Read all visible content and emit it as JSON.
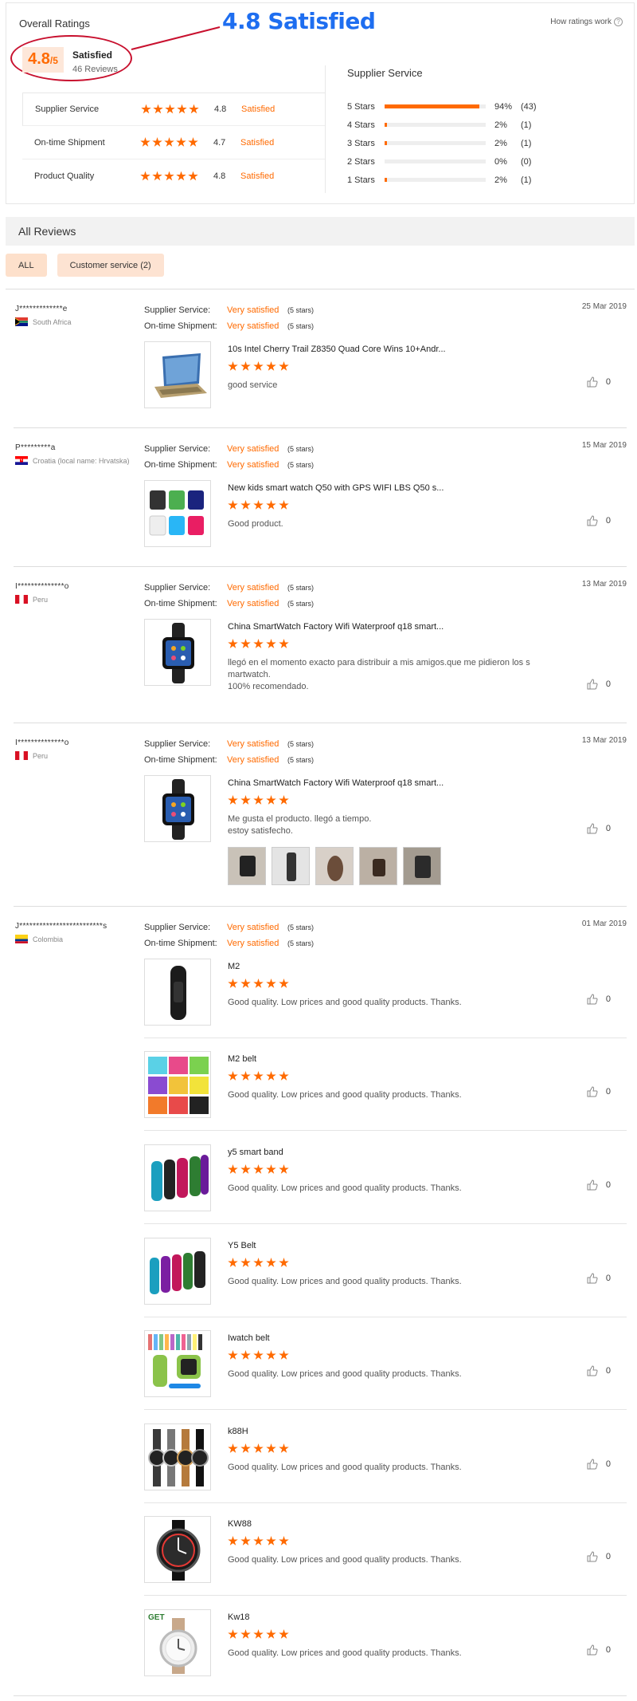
{
  "overall": {
    "title": "Overall Ratings",
    "how_link": "How ratings work",
    "score_main": "4.8",
    "score_suffix": "/5",
    "score_label": "Satisfied",
    "review_count": "46 Reviews",
    "annotation": "4.8 Satisfied"
  },
  "metrics": [
    {
      "name": "Supplier Service",
      "stars": 5,
      "value": "4.8",
      "word": "Satisfied"
    },
    {
      "name": "On-time Shipment",
      "stars": 5,
      "value": "4.7",
      "word": "Satisfied"
    },
    {
      "name": "Product Quality",
      "stars": 5,
      "value": "4.8",
      "word": "Satisfied"
    }
  ],
  "distribution": {
    "title": "Supplier Service",
    "rows": [
      {
        "label": "5 Stars",
        "fraction": 0.94,
        "pct": "94%",
        "count": "(43)"
      },
      {
        "label": "4 Stars",
        "fraction": 0.02,
        "pct": "2%",
        "count": "(1)"
      },
      {
        "label": "3 Stars",
        "fraction": 0.02,
        "pct": "2%",
        "count": "(1)"
      },
      {
        "label": "2 Stars",
        "fraction": 0.0,
        "pct": "0%",
        "count": "(0)"
      },
      {
        "label": "1 Stars",
        "fraction": 0.02,
        "pct": "2%",
        "count": "(1)"
      }
    ]
  },
  "reviews_header": "All Reviews",
  "filters": {
    "all": "ALL",
    "customer_service": "Customer service (2)"
  },
  "svc_labels": {
    "supplier": "Supplier Service:",
    "shipment": "On-time Shipment:",
    "value": "Very satisfied",
    "stars": "(5 stars)"
  },
  "reviews": [
    {
      "reviewer": "J*************e",
      "country": "South Africa",
      "date": "25 Mar 2019",
      "items": [
        {
          "title": "10s Intel Cherry Trail Z8350 Quad Core Wins 10+Andr...",
          "text": "good service",
          "likes": "0"
        }
      ]
    },
    {
      "reviewer": "P*********a",
      "country": "Croatia (local name: Hrvatska)",
      "date": "15 Mar 2019",
      "items": [
        {
          "title": "New kids smart watch Q50 with GPS WIFI LBS Q50 s...",
          "text": "Good product.",
          "likes": "0"
        }
      ]
    },
    {
      "reviewer": "I**************o",
      "country": "Peru",
      "date": "13 Mar 2019",
      "items": [
        {
          "title": "China SmartWatch Factory Wifi Waterproof q18 smart...",
          "text1": "llegó en el momento exacto para distribuir a mis amigos.que me pidieron los s",
          "text2": "martwatch.",
          "text3": "100% recomendado.",
          "likes": "0"
        }
      ]
    },
    {
      "reviewer": "I**************o",
      "country": "Peru",
      "date": "13 Mar 2019",
      "items": [
        {
          "title": "China SmartWatch Factory Wifi Waterproof q18 smart...",
          "text1": "Me gusta el producto. llegó a tiempo.",
          "text2": "estoy satisfecho.",
          "likes": "0"
        }
      ]
    },
    {
      "reviewer": "J*************************s",
      "country": "Colombia",
      "date": "01 Mar 2019",
      "items": [
        {
          "title": "M2",
          "text": "Good quality. Low prices and good quality products. Thanks.",
          "likes": "0"
        },
        {
          "title": "M2 belt",
          "text": "Good quality. Low prices and good quality products. Thanks.",
          "likes": "0"
        },
        {
          "title": "y5 smart band",
          "text": "Good quality. Low prices and good quality products. Thanks.",
          "likes": "0"
        },
        {
          "title": "Y5 Belt",
          "text": "Good quality. Low prices and good quality products. Thanks.",
          "likes": "0"
        },
        {
          "title": "Iwatch belt",
          "text": "Good quality. Low prices and good quality products. Thanks.",
          "likes": "0"
        },
        {
          "title": "k88H",
          "text": "Good quality. Low prices and good quality products. Thanks.",
          "likes": "0"
        },
        {
          "title": "KW88",
          "text": "Good quality. Low prices and good quality products. Thanks.",
          "likes": "0"
        },
        {
          "title": "Kw18",
          "text": "Good quality. Low prices and good quality products. Thanks.",
          "likes": "0",
          "badge": "GET"
        }
      ]
    }
  ],
  "colors": {
    "accent": "#ff6a00",
    "annotation": "#1e6ef0",
    "highlight": "#c8102e"
  }
}
